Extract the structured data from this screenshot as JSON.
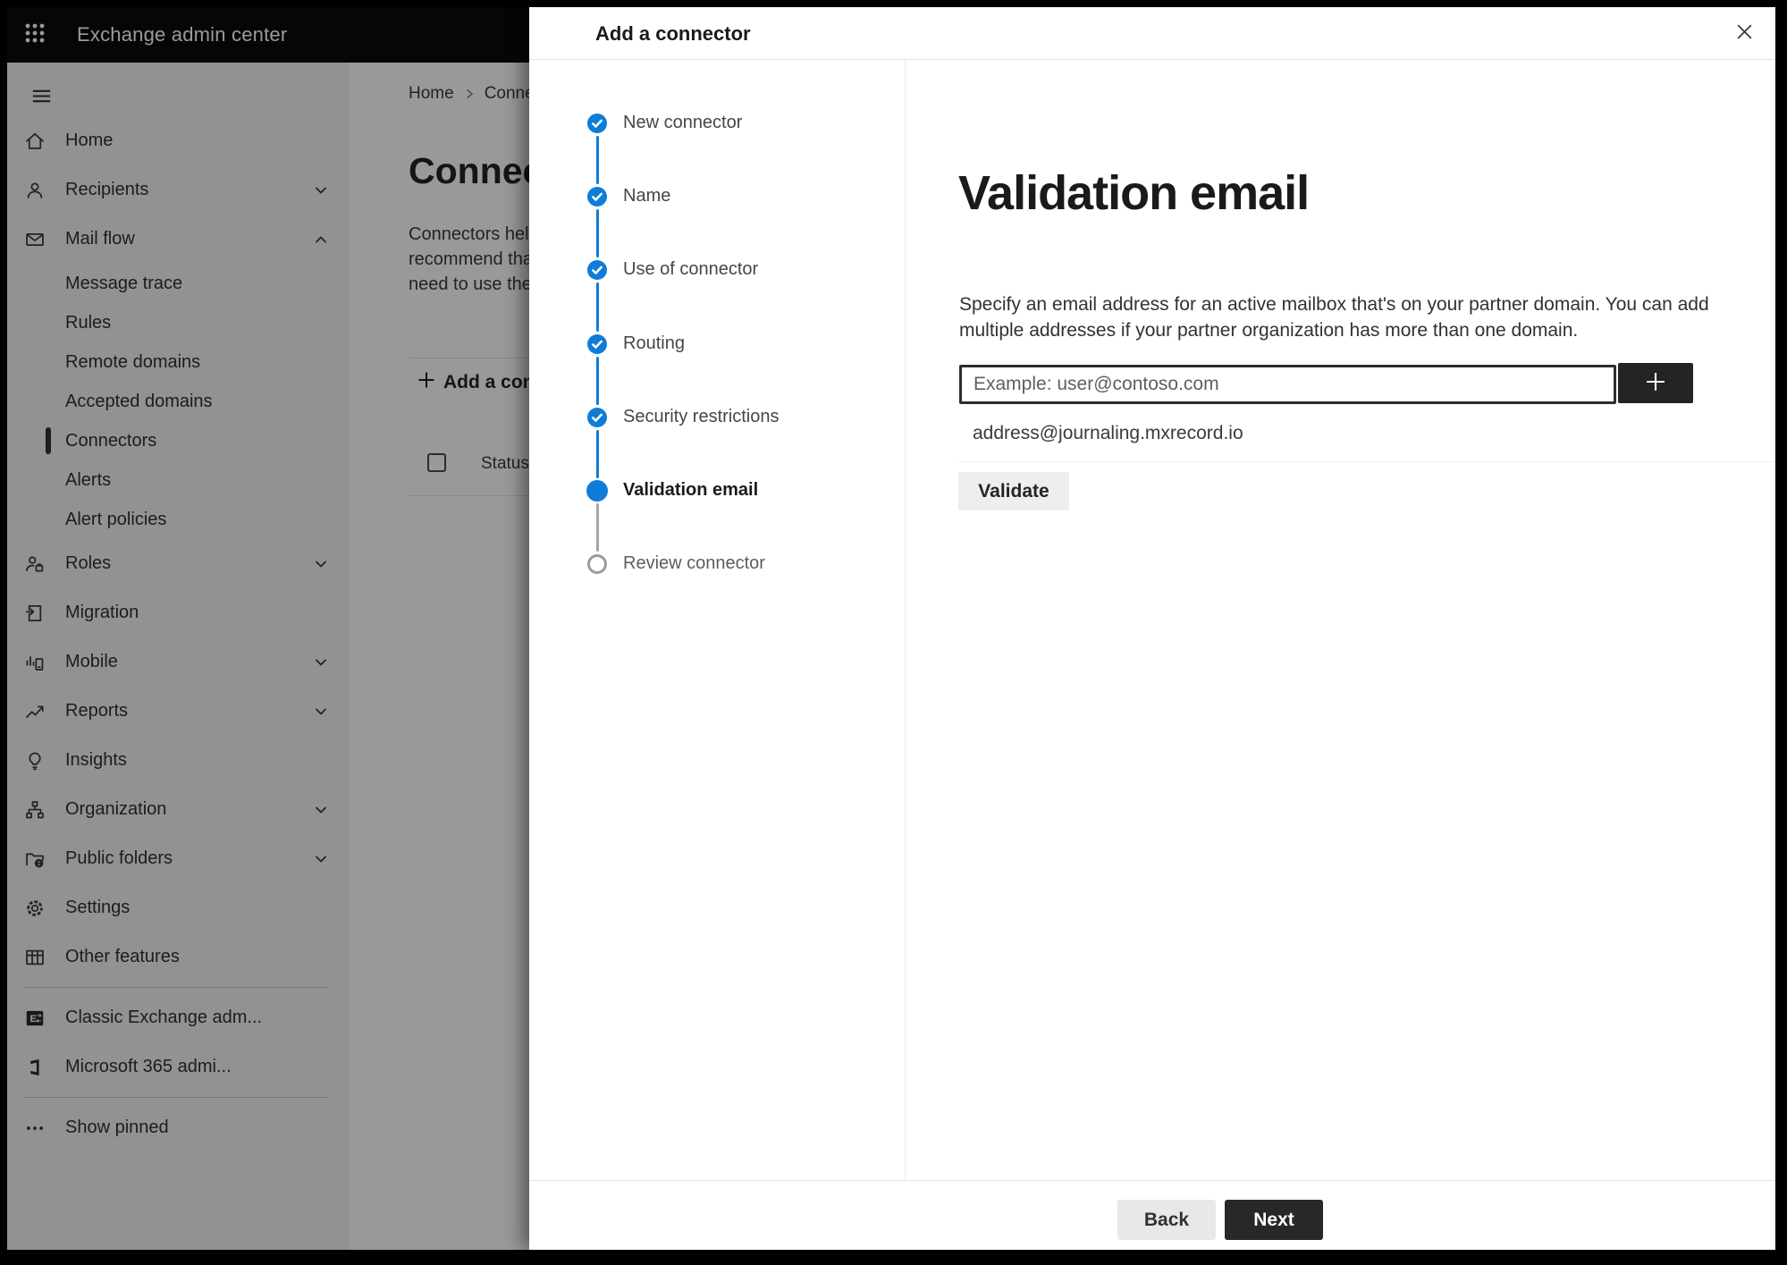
{
  "colors": {
    "accent_blue": "#0f7dd7",
    "topbar_bg": "#0a0a0a",
    "primary_button_bg": "#282828",
    "overlay": "rgba(0,0,0,0.40)"
  },
  "topbar": {
    "app_title": "Exchange admin center"
  },
  "sidebar": {
    "items": [
      {
        "type": "item",
        "icon": "home",
        "label": "Home"
      },
      {
        "type": "item",
        "icon": "person",
        "label": "Recipients",
        "chevron": "down"
      },
      {
        "type": "item",
        "icon": "mail",
        "label": "Mail flow",
        "chevron": "up"
      },
      {
        "type": "sub",
        "label": "Message trace"
      },
      {
        "type": "sub",
        "label": "Rules"
      },
      {
        "type": "sub",
        "label": "Remote domains"
      },
      {
        "type": "sub",
        "label": "Accepted domains"
      },
      {
        "type": "sub",
        "label": "Connectors",
        "selected": true
      },
      {
        "type": "sub",
        "label": "Alerts"
      },
      {
        "type": "sub",
        "label": "Alert policies"
      },
      {
        "type": "item",
        "icon": "roles",
        "label": "Roles",
        "chevron": "down"
      },
      {
        "type": "item",
        "icon": "migration",
        "label": "Migration"
      },
      {
        "type": "item",
        "icon": "mobile",
        "label": "Mobile",
        "chevron": "down"
      },
      {
        "type": "item",
        "icon": "reports",
        "label": "Reports",
        "chevron": "down"
      },
      {
        "type": "item",
        "icon": "insights",
        "label": "Insights"
      },
      {
        "type": "item",
        "icon": "organization",
        "label": "Organization",
        "chevron": "down"
      },
      {
        "type": "item",
        "icon": "public-folders",
        "label": "Public folders",
        "chevron": "down"
      },
      {
        "type": "item",
        "icon": "settings",
        "label": "Settings"
      },
      {
        "type": "item",
        "icon": "other-features",
        "label": "Other features"
      },
      {
        "type": "divider"
      },
      {
        "type": "item",
        "icon": "classic-exchange",
        "label": "Classic Exchange adm..."
      },
      {
        "type": "item",
        "icon": "microsoft-365",
        "label": "Microsoft 365 admi..."
      },
      {
        "type": "divider"
      },
      {
        "type": "item",
        "icon": "ellipsis",
        "label": "Show pinned"
      }
    ]
  },
  "background_page": {
    "breadcrumb": {
      "home": "Home",
      "current_fragment": "Conne"
    },
    "title_fragment": "Connec",
    "description_fragments": [
      "Connectors help",
      "recommend tha",
      "need to use ther"
    ],
    "add_button_fragment": "Add a conn",
    "table_header_status": "Status"
  },
  "panel": {
    "title": "Add a connector",
    "steps": [
      {
        "label": "New connector",
        "state": "completed"
      },
      {
        "label": "Name",
        "state": "completed"
      },
      {
        "label": "Use of connector",
        "state": "completed"
      },
      {
        "label": "Routing",
        "state": "completed"
      },
      {
        "label": "Security restrictions",
        "state": "completed"
      },
      {
        "label": "Validation email",
        "state": "current"
      },
      {
        "label": "Review connector",
        "state": "upcoming"
      }
    ],
    "content": {
      "heading": "Validation email",
      "description_line1": "Specify an email address for an active mailbox that's on your partner domain. You can add",
      "description_line2": "multiple addresses if your partner organization has more than one domain.",
      "input_placeholder": "Example: user@contoso.com",
      "email_address": "address@journaling.mxrecord.io",
      "validate_label": "Validate"
    },
    "footer": {
      "back_label": "Back",
      "next_label": "Next"
    }
  }
}
